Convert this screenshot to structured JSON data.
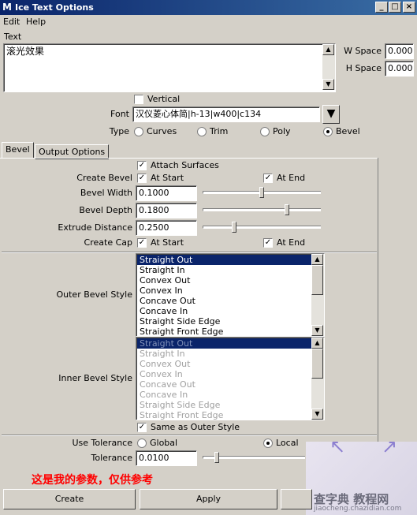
{
  "window": {
    "title": "Ice Text Options",
    "minimize": "_",
    "maximize": "□",
    "close": "×"
  },
  "menu": {
    "edit": "Edit",
    "help": "Help"
  },
  "text_section": {
    "label": "Text",
    "value": "滚光效果",
    "w_space_label": "W Space",
    "w_space_value": "0.000",
    "h_space_label": "H Space",
    "h_space_value": "0.000"
  },
  "vertical": {
    "label": "Vertical",
    "checked": false
  },
  "font": {
    "label": "Font",
    "value": "汉仪菱心体简|h-13|w400|c134"
  },
  "type": {
    "label": "Type",
    "options": [
      "Curves",
      "Trim",
      "Poly",
      "Bevel"
    ],
    "selected": "Bevel"
  },
  "tabs": [
    "Bevel",
    "Output Options"
  ],
  "active_tab": "Bevel",
  "bevel": {
    "attach_surfaces": "Attach Surfaces",
    "create_bevel_label": "Create Bevel",
    "at_start": "At Start",
    "at_end": "At End",
    "bevel_width_label": "Bevel Width",
    "bevel_width": "0.1000",
    "bevel_width_level": 0.5,
    "bevel_depth_label": "Bevel Depth",
    "bevel_depth": "0.1800",
    "bevel_depth_level": 0.72,
    "extrude_distance_label": "Extrude Distance",
    "extrude_distance": "0.2500",
    "extrude_distance_level": 0.26,
    "create_cap_label": "Create Cap",
    "outer_bevel_style_label": "Outer Bevel Style",
    "inner_bevel_style_label": "Inner Bevel Style",
    "styles": [
      "Straight Out",
      "Straight In",
      "Convex Out",
      "Convex In",
      "Concave Out",
      "Concave In",
      "Straight Side Edge",
      "Straight Front Edge"
    ],
    "outer_selected": "Straight Out",
    "inner_selected": "Straight Out",
    "same_as_outer": "Same as Outer Style",
    "use_tolerance_label": "Use Tolerance",
    "tolerance_options": [
      "Global",
      "Local"
    ],
    "tolerance_selected": "Local",
    "tolerance_label": "Tolerance",
    "tolerance_value": "0.0100",
    "tolerance_level": 0.12
  },
  "annotation": "这是我的参数，仅供参考",
  "watermark": {
    "main": "查字典 教程网",
    "sub": "jiaocheng.chazidian.com"
  },
  "buttons": {
    "create": "Create",
    "apply": "Apply"
  },
  "colors": {
    "selection": "#0a246a",
    "annotation": "#ff0000",
    "titlebar": "#0a246a"
  }
}
